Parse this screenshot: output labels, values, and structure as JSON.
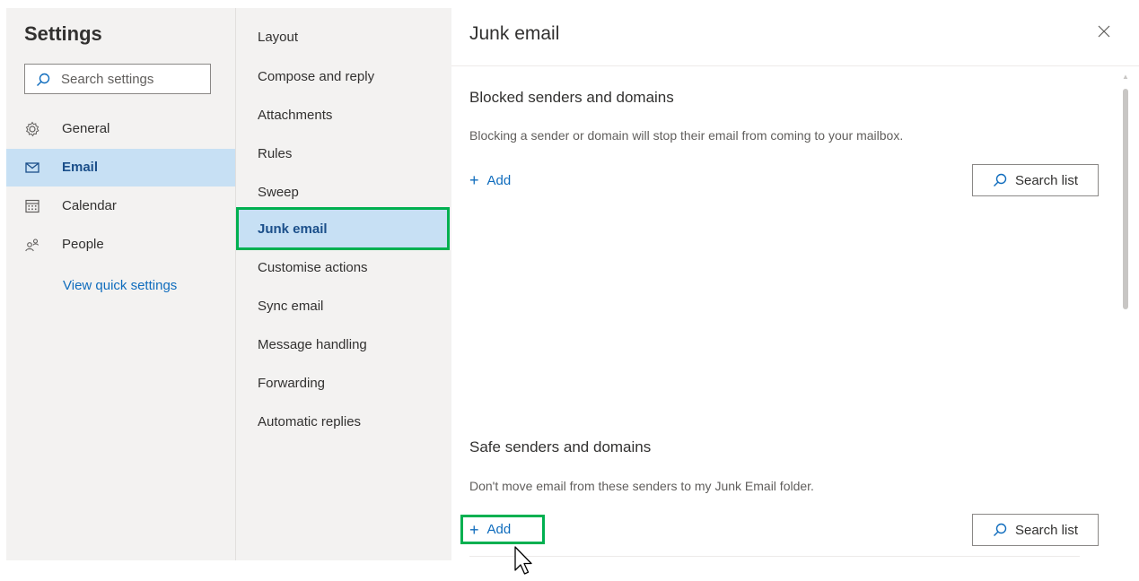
{
  "settings": {
    "title": "Settings",
    "search_placeholder": "Search settings",
    "categories": [
      {
        "label": "General",
        "icon": "gear-icon"
      },
      {
        "label": "Email",
        "icon": "mail-icon",
        "selected": true
      },
      {
        "label": "Calendar",
        "icon": "calendar-icon"
      },
      {
        "label": "People",
        "icon": "people-icon"
      }
    ],
    "quick_settings_link": "View quick settings"
  },
  "email_subnav": {
    "items": [
      "Layout",
      "Compose and reply",
      "Attachments",
      "Rules",
      "Sweep",
      "Junk email",
      "Customise actions",
      "Sync email",
      "Message handling",
      "Forwarding",
      "Automatic replies"
    ],
    "selected": "Junk email"
  },
  "panel": {
    "title": "Junk email",
    "blocked": {
      "title": "Blocked senders and domains",
      "description": "Blocking a sender or domain will stop their email from coming to your mailbox.",
      "add_label": "Add",
      "search_label": "Search list"
    },
    "safe": {
      "title": "Safe senders and domains",
      "description": "Don't move email from these senders to my Junk Email folder.",
      "add_label": "Add",
      "search_label": "Search list"
    }
  },
  "colors": {
    "accent": "#0f6cbd",
    "selected_bg": "#c7e0f4",
    "highlight_border": "#00b050",
    "pane_bg": "#f3f2f1"
  }
}
